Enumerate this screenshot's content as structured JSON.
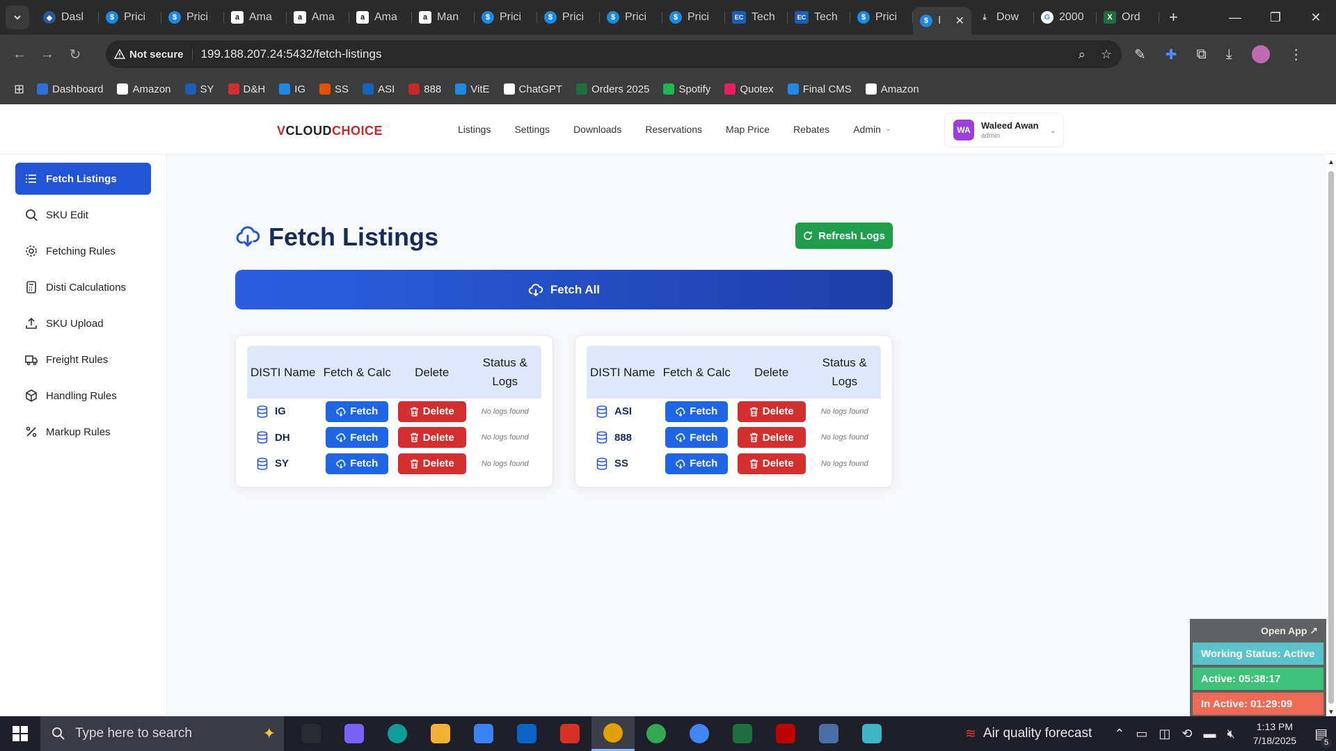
{
  "browser": {
    "tabs": [
      {
        "icon": "fav-ms",
        "label": "Dasl"
      },
      {
        "icon": "fav-s",
        "label": "Prici"
      },
      {
        "icon": "fav-s",
        "label": "Prici"
      },
      {
        "icon": "fav-a",
        "label": "Ama"
      },
      {
        "icon": "fav-a",
        "label": "Ama"
      },
      {
        "icon": "fav-a",
        "label": "Ama"
      },
      {
        "icon": "fav-a",
        "label": "Man"
      },
      {
        "icon": "fav-s",
        "label": "Prici"
      },
      {
        "icon": "fav-s",
        "label": "Prici"
      },
      {
        "icon": "fav-s",
        "label": "Prici"
      },
      {
        "icon": "fav-s",
        "label": "Prici"
      },
      {
        "icon": "fav-ec",
        "label": "Tech"
      },
      {
        "icon": "fav-ec",
        "label": "Tech"
      },
      {
        "icon": "fav-s",
        "label": "Prici"
      }
    ],
    "active_tab_label": "I",
    "tabs_after": [
      {
        "icon": "fav-dl",
        "label": "Dow"
      },
      {
        "icon": "fav-g",
        "label": "2000"
      },
      {
        "icon": "fav-x",
        "label": "Ord"
      }
    ],
    "not_secure": "Not secure",
    "url": "199.188.207.24:5432/fetch-listings",
    "bookmarks": [
      {
        "label": "Dashboard",
        "color": "#2d6fd6"
      },
      {
        "label": "Amazon",
        "color": "#ffffff"
      },
      {
        "label": "SY",
        "color": "#1a5fb4"
      },
      {
        "label": "D&H",
        "color": "#d32f2f"
      },
      {
        "label": "IG",
        "color": "#1e88e5"
      },
      {
        "label": "SS",
        "color": "#e65100"
      },
      {
        "label": "ASI",
        "color": "#1565c0"
      },
      {
        "label": "888",
        "color": "#c62828"
      },
      {
        "label": "VitE",
        "color": "#1e88e5"
      },
      {
        "label": "ChatGPT",
        "color": "#ffffff"
      },
      {
        "label": "Orders 2025",
        "color": "#1d6f42"
      },
      {
        "label": "Spotify",
        "color": "#1db954"
      },
      {
        "label": "Quotex",
        "color": "#e91e63"
      },
      {
        "label": "Final CMS",
        "color": "#1e88e5"
      },
      {
        "label": "Amazon",
        "color": "#ffffff"
      }
    ]
  },
  "header": {
    "logo_v": "V",
    "logo_cloud": "CLOUD",
    "logo_choice": "CHOICE",
    "nav": [
      "Listings",
      "Settings",
      "Downloads",
      "Reservations",
      "Map Price",
      "Rebates",
      "Admin"
    ],
    "user": {
      "initials": "WA",
      "name": "Waleed Awan",
      "role": "admin"
    }
  },
  "sidebar": {
    "items": [
      {
        "label": "Fetch Listings",
        "icon": "list-icon",
        "active": true
      },
      {
        "label": "SKU Edit",
        "icon": "search-icon",
        "active": false
      },
      {
        "label": "Fetching Rules",
        "icon": "gear-icon",
        "active": false
      },
      {
        "label": "Disti Calculations",
        "icon": "calculator-icon",
        "active": false
      },
      {
        "label": "SKU Upload",
        "icon": "upload-icon",
        "active": false
      },
      {
        "label": "Freight Rules",
        "icon": "truck-icon",
        "active": false
      },
      {
        "label": "Handling Rules",
        "icon": "box-icon",
        "active": false
      },
      {
        "label": "Markup Rules",
        "icon": "percent-icon",
        "active": false
      }
    ]
  },
  "main": {
    "title": "Fetch Listings",
    "refresh_label": "Refresh Logs",
    "fetch_all_label": "Fetch All",
    "columns": [
      "DISTI Name",
      "Fetch & Calc",
      "Delete",
      "Status & Logs"
    ],
    "fetch_label": "Fetch",
    "delete_label": "Delete",
    "no_logs": "No logs found",
    "left_rows": [
      "IG",
      "DH",
      "SY"
    ],
    "right_rows": [
      "ASI",
      "888",
      "SS"
    ]
  },
  "widget": {
    "open_app": "Open App ↗",
    "working": "Working Status: Active",
    "active": "Active: 05:38:17",
    "inactive": "In Active: 01:29:09"
  },
  "taskbar": {
    "search_placeholder": "Type here to search",
    "weather": "Air quality forecast",
    "time": "1:13 PM",
    "date": "7/18/2025",
    "notifications": "5",
    "apps": [
      {
        "name": "task-view",
        "color": "#2b2b34"
      },
      {
        "name": "copilot",
        "color": "#7b61ff"
      },
      {
        "name": "edge",
        "color": "#0f9d9a"
      },
      {
        "name": "file-explorer",
        "color": "#f2b233"
      },
      {
        "name": "store",
        "color": "#3b82f6"
      },
      {
        "name": "outlook",
        "color": "#0a64c8"
      },
      {
        "name": "calendar",
        "color": "#d93025"
      },
      {
        "name": "chrome-active",
        "color": "#e0a100"
      },
      {
        "name": "chrome",
        "color": "#34a853"
      },
      {
        "name": "chrome-2",
        "color": "#4285f4"
      },
      {
        "name": "excel",
        "color": "#1d6f42"
      },
      {
        "name": "filezilla",
        "color": "#bf0000"
      },
      {
        "name": "calculator",
        "color": "#4a6fa5"
      },
      {
        "name": "app",
        "color": "#3fb6c8"
      }
    ]
  }
}
